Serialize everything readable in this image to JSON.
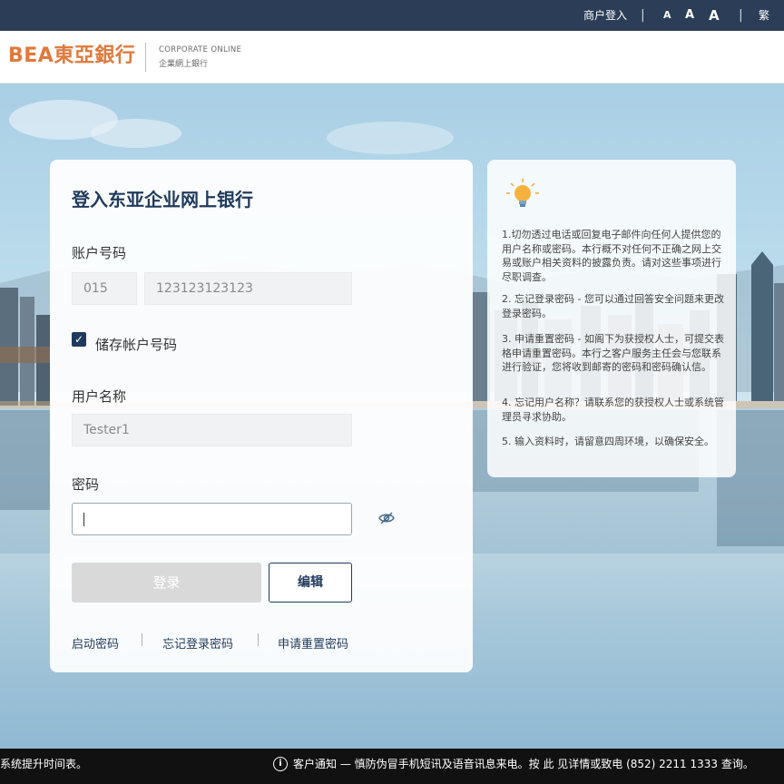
{
  "topbar": {
    "merchant_login": "商户登入",
    "font_small": "A",
    "font_medium": "A",
    "font_large": "A",
    "lang_trad": "繁",
    "sep": "|"
  },
  "header": {
    "logo_text": "BEA東亞銀行",
    "corporate_online": "CORPORATE ONLINE",
    "corporate_online_cn": "企業網上銀行"
  },
  "login": {
    "title": "登入东亚企业网上银行",
    "account_label": "账户号码",
    "branch_code": "015",
    "account_number": "123123123123",
    "remember_label": "储存帐户号码",
    "remember_checked": true,
    "username_label": "用户名称",
    "username_value": "Tester1",
    "password_label": "密码",
    "password_value": "",
    "login_button": "登录",
    "edit_button": "编辑",
    "links": [
      "启动密码",
      "忘记登录密码",
      "申请重置密码"
    ]
  },
  "tips": {
    "icon": "lightbulb-icon",
    "items": [
      "1.切勿透过电话或回复电子邮件向任何人提供您的用户名称或密码。本行概不对任何不正确之网上交易或账户相关资料的披露负责。请对这些事项进行尽职调查。",
      "2. 忘记登录密码 - 您可以通过回答安全问题来更改登录密码。",
      "3. 申请重置密码 - 如阁下为获授权人士，可提交表格申请重置密码。本行之客户服务主任会与您联系进行验证，您将收到邮寄的密码和密码确认信。",
      "4. 忘记用户名称？请联系您的获授权人士或系统管理员寻求协助。",
      "5. 输入资料时，请留意四周环境，以确保安全。"
    ]
  },
  "footer": {
    "left_text": "系统提升时间表。",
    "notice": "客户通知 — 慎防伪冒手机短讯及语音讯息来电。按 此 见详情或致电 (852) 2211 1333 查询。"
  },
  "colors": {
    "topbar": "#2b3d57",
    "brand_orange": "#e0793b",
    "primary_navy": "#1f3a5c",
    "footer": "#111111"
  }
}
